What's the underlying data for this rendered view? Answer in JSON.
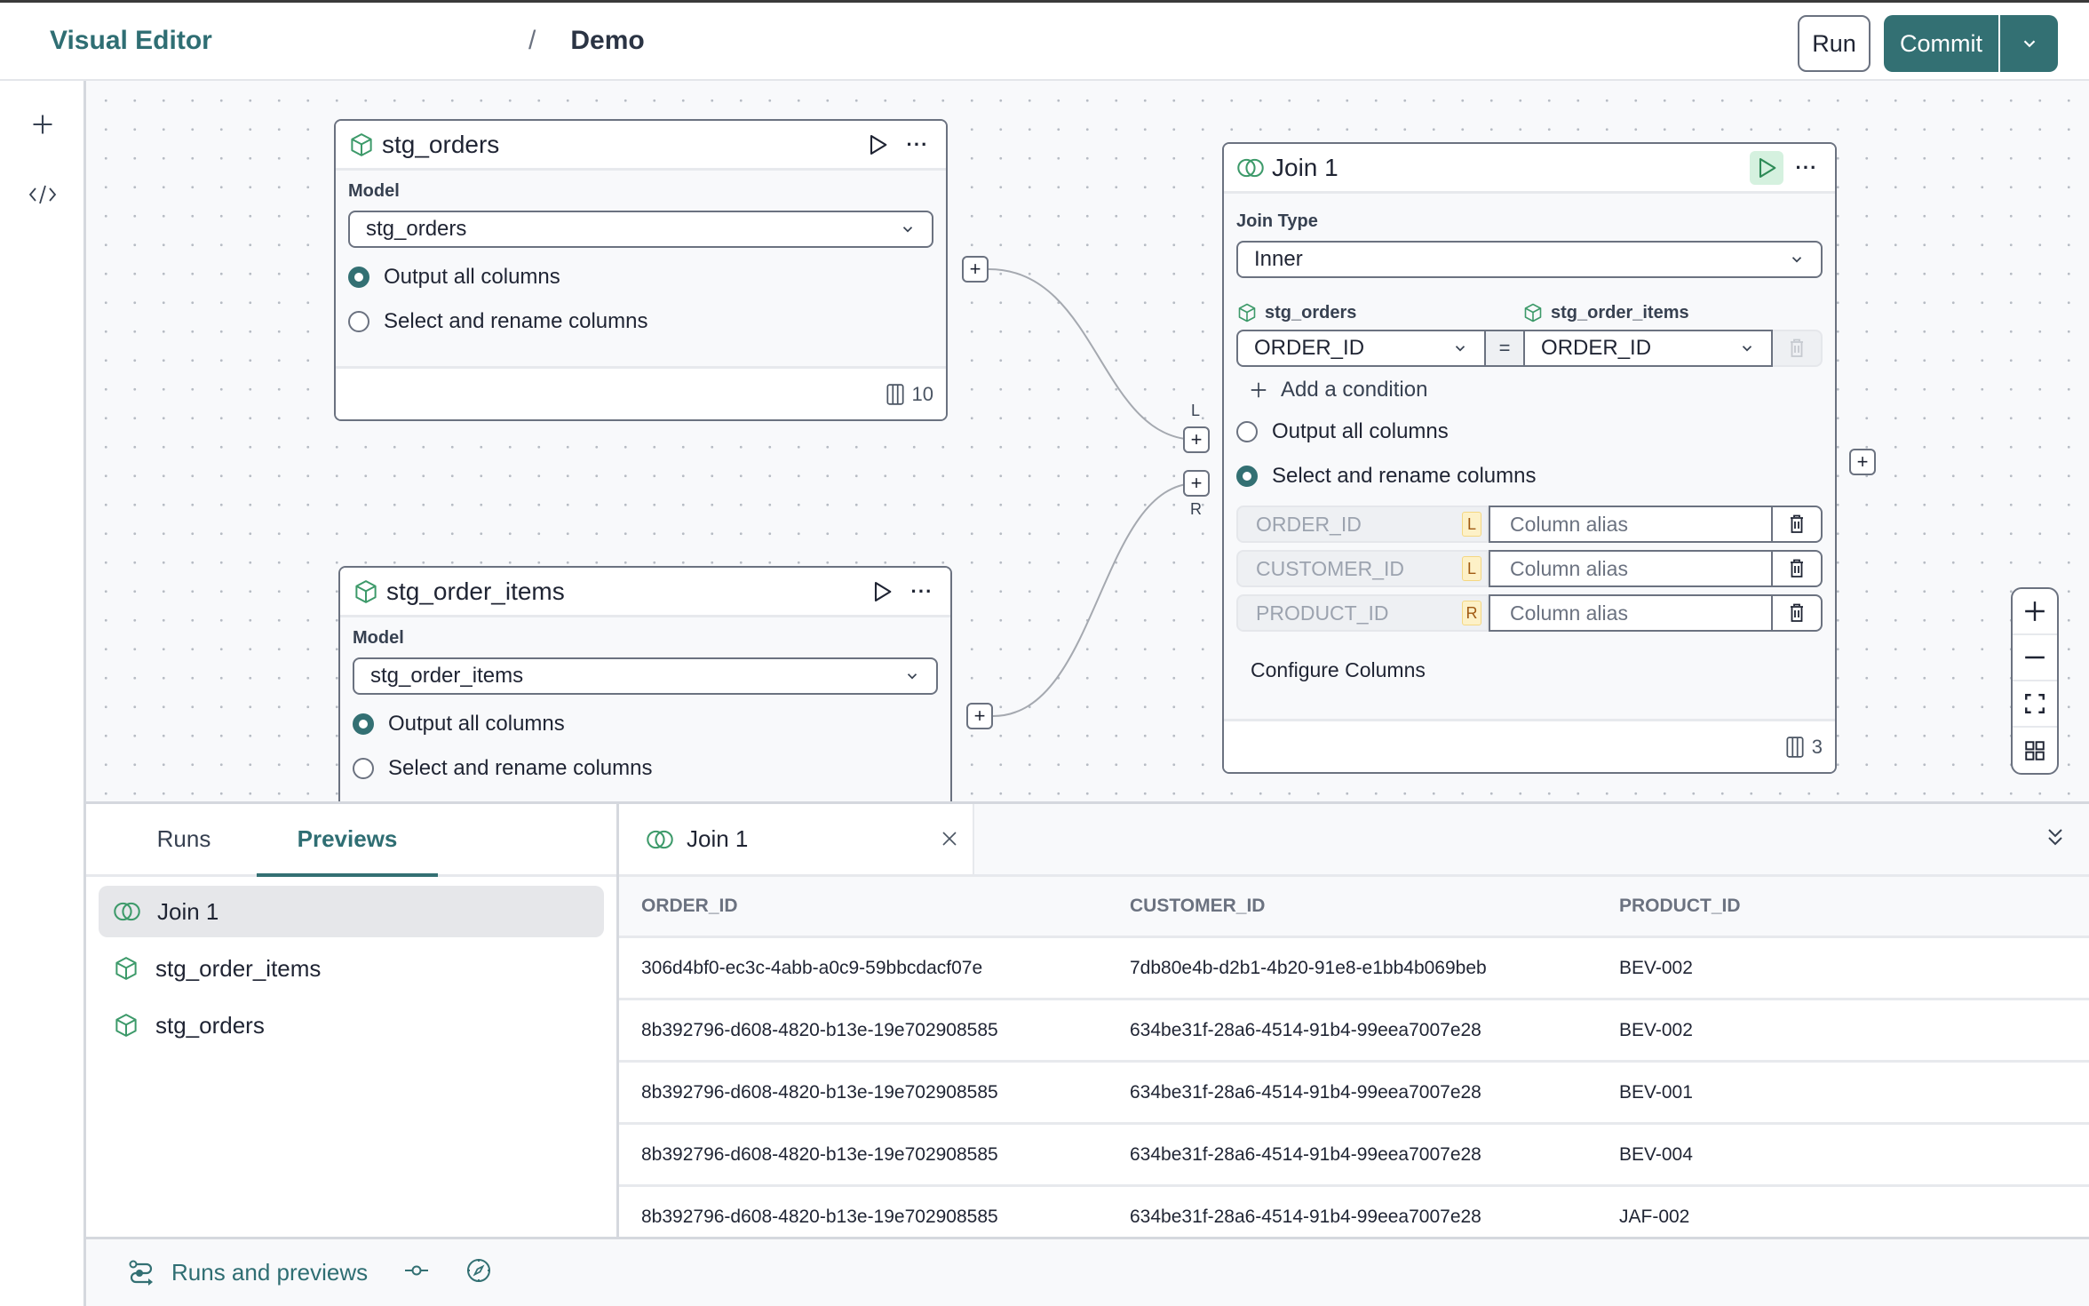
{
  "header": {
    "breadcrumb_root": "Visual Editor",
    "breadcrumb_sep": "/",
    "breadcrumb_current": "Demo",
    "run_label": "Run",
    "commit_label": "Commit"
  },
  "colors": {
    "accent": "#337073",
    "node_icon": "#3d9a6a",
    "badge_bg": "#fdf1c7"
  },
  "rail": {
    "add_icon": "plus-icon",
    "code_icon": "code-icon"
  },
  "nodes": {
    "stg_orders": {
      "title": "stg_orders",
      "model_label": "Model",
      "model_value": "stg_orders",
      "option_all": "Output all columns",
      "option_select": "Select and rename columns",
      "selected": "all",
      "column_count": "10"
    },
    "stg_order_items": {
      "title": "stg_order_items",
      "model_label": "Model",
      "model_value": "stg_order_items",
      "option_all": "Output all columns",
      "option_select": "Select and rename columns",
      "selected": "all"
    },
    "join": {
      "title": "Join 1",
      "join_type_label": "Join Type",
      "join_type_value": "Inner",
      "left_source": "stg_orders",
      "right_source": "stg_order_items",
      "left_key": "ORDER_ID",
      "eq": "=",
      "right_key": "ORDER_ID",
      "add_condition": "Add a condition",
      "option_all": "Output all columns",
      "option_select": "Select and rename columns",
      "selected": "select",
      "columns": [
        {
          "name": "ORDER_ID",
          "side": "L",
          "alias_placeholder": "Column alias"
        },
        {
          "name": "CUSTOMER_ID",
          "side": "L",
          "alias_placeholder": "Column alias"
        },
        {
          "name": "PRODUCT_ID",
          "side": "R",
          "alias_placeholder": "Column alias"
        }
      ],
      "configure_columns": "Configure Columns",
      "column_count": "3",
      "port_left_label": "L",
      "port_right_label": "R"
    }
  },
  "bottom": {
    "tabs": [
      {
        "label": "Runs"
      },
      {
        "label": "Previews"
      }
    ],
    "active_tab": "Previews",
    "preview_list": [
      {
        "label": "Join 1",
        "icon": "join-icon",
        "selected": true
      },
      {
        "label": "stg_order_items",
        "icon": "model-icon",
        "selected": false
      },
      {
        "label": "stg_orders",
        "icon": "model-icon",
        "selected": false
      }
    ],
    "open_tab": "Join 1",
    "table": {
      "columns": [
        "ORDER_ID",
        "CUSTOMER_ID",
        "PRODUCT_ID"
      ],
      "rows": [
        [
          "306d4bf0-ec3c-4abb-a0c9-59bbcdacf07e",
          "7db80e4b-d2b1-4b20-91e8-e1bb4b069beb",
          "BEV-002"
        ],
        [
          "8b392796-d608-4820-b13e-19e702908585",
          "634be31f-28a6-4514-91b4-99eea7007e28",
          "BEV-002"
        ],
        [
          "8b392796-d608-4820-b13e-19e702908585",
          "634be31f-28a6-4514-91b4-99eea7007e28",
          "BEV-001"
        ],
        [
          "8b392796-d608-4820-b13e-19e702908585",
          "634be31f-28a6-4514-91b4-99eea7007e28",
          "BEV-004"
        ],
        [
          "8b392796-d608-4820-b13e-19e702908585",
          "634be31f-28a6-4514-91b4-99eea7007e28",
          "JAF-002"
        ]
      ]
    }
  },
  "statusbar": {
    "runs_previews_label": "Runs and previews"
  }
}
